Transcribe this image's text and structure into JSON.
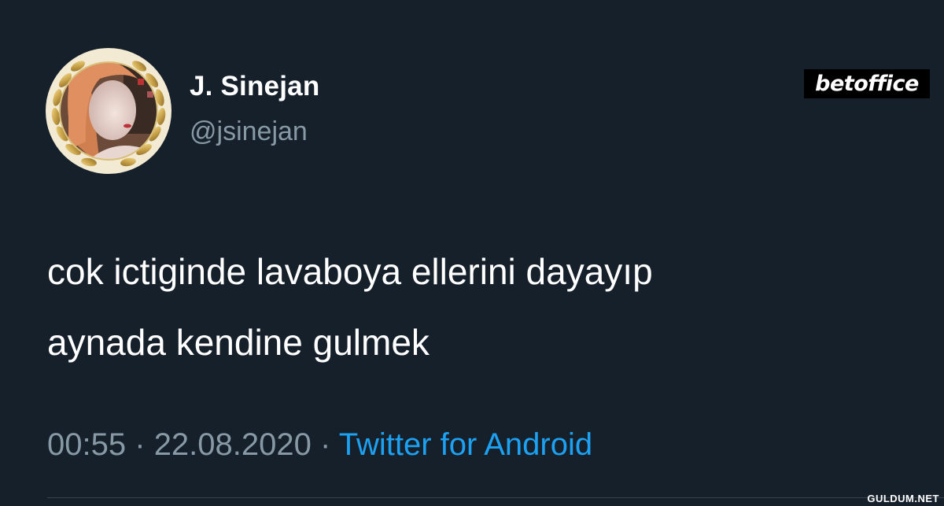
{
  "profile": {
    "display_name": "J. Sinejan",
    "handle": "@jsinejan",
    "avatar_icon": "profile-photo-with-laurel-wreath"
  },
  "watermark": {
    "brand": "betoffice"
  },
  "tweet": {
    "lines": [
      "cok ictiginde lavaboya ellerini dayayıp",
      "aynada kendine gulmek"
    ],
    "time": "00:55",
    "date": "22.08.2020",
    "separator": "·",
    "source": "Twitter for Android"
  },
  "footer": {
    "site_mark": "GULDUM.NET"
  },
  "colors": {
    "background": "#15202b",
    "primary_text": "#ffffff",
    "secondary_text": "#8899a6",
    "link": "#1da1f2",
    "laurel_gold": "#c9a84c"
  }
}
